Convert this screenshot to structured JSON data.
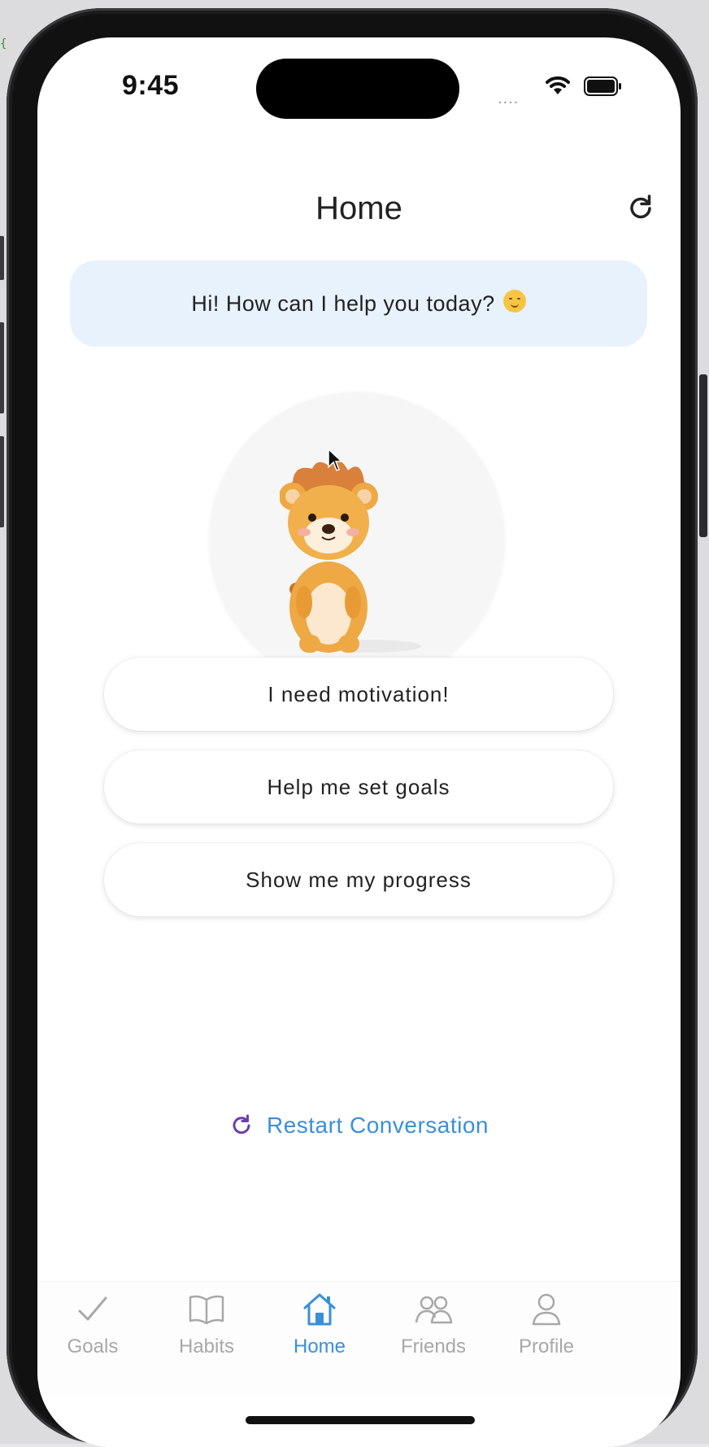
{
  "status_bar": {
    "time": "9:45",
    "signal_dots": "....",
    "wifi_icon": "wifi-icon",
    "battery_icon": "battery-icon"
  },
  "header": {
    "title": "Home",
    "refresh_icon": "refresh-icon"
  },
  "greeting": {
    "text": "Hi! How can I help you today?",
    "emoji_icon": "smiling-face-icon"
  },
  "mascot": {
    "icon": "lion-mascot"
  },
  "options": [
    {
      "label": "I need motivation!"
    },
    {
      "label": "Help me set goals"
    },
    {
      "label": "Show me my progress"
    }
  ],
  "restart": {
    "label": "Restart Conversation",
    "icon": "refresh-icon"
  },
  "tabs": [
    {
      "label": "Goals",
      "icon": "checkmark-icon",
      "active": false
    },
    {
      "label": "Habits",
      "icon": "book-icon",
      "active": false
    },
    {
      "label": "Home",
      "icon": "home-icon",
      "active": true
    },
    {
      "label": "Friends",
      "icon": "people-icon",
      "active": false
    },
    {
      "label": "Profile",
      "icon": "person-icon",
      "active": false
    }
  ],
  "colors": {
    "accent": "#3b8fd9",
    "greeting_bg": "#e8f2fc",
    "tab_inactive": "#a8a8a8",
    "restart_icon": "#6a3fb0"
  }
}
